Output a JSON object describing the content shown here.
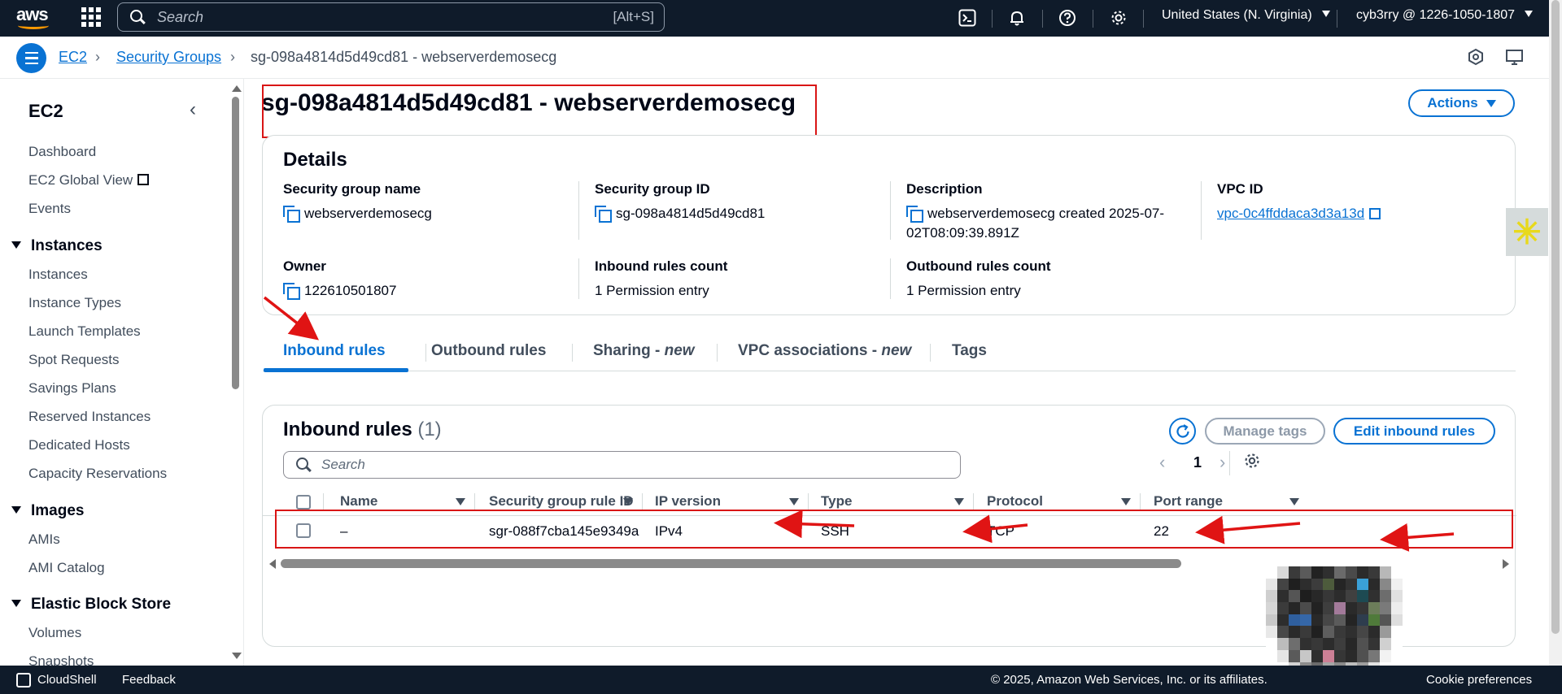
{
  "topnav": {
    "logo_text": "aws",
    "search_placeholder": "Search",
    "search_shortcut": "[Alt+S]",
    "region": "United States (N. Virginia)",
    "account": "cyb3rry @ 1226-1050-1807",
    "icons": [
      "cloudshell-icon",
      "bell-icon",
      "help-icon",
      "gear-icon"
    ]
  },
  "breadcrumb": {
    "items": [
      "EC2",
      "Security Groups",
      "sg-098a4814d5d49cd81 - webserverdemosecg"
    ]
  },
  "sidebar": {
    "title": "EC2",
    "top_items": [
      "Dashboard",
      "EC2 Global View",
      "Events"
    ],
    "sections": [
      {
        "title": "Instances",
        "items": [
          "Instances",
          "Instance Types",
          "Launch Templates",
          "Spot Requests",
          "Savings Plans",
          "Reserved Instances",
          "Dedicated Hosts",
          "Capacity Reservations"
        ]
      },
      {
        "title": "Images",
        "items": [
          "AMIs",
          "AMI Catalog"
        ]
      },
      {
        "title": "Elastic Block Store",
        "items": [
          "Volumes",
          "Snapshots"
        ]
      }
    ]
  },
  "page": {
    "title": "sg-098a4814d5d49cd81 - webserverdemosecg",
    "actions_label": "Actions"
  },
  "details": {
    "heading": "Details",
    "sg_name_label": "Security group name",
    "sg_name": "webserverdemosecg",
    "sg_id_label": "Security group ID",
    "sg_id": "sg-098a4814d5d49cd81",
    "description_label": "Description",
    "description_line1": "webserverdemosecg created 2025-07-",
    "description_line2": "02T08:09:39.891Z",
    "vpc_label": "VPC ID",
    "vpc_id": "vpc-0c4ffddaca3d3a13d",
    "owner_label": "Owner",
    "owner": "122610501807",
    "inbound_count_label": "Inbound rules count",
    "inbound_count": "1 Permission entry",
    "outbound_count_label": "Outbound rules count",
    "outbound_count": "1 Permission entry"
  },
  "tabs": [
    {
      "label": "Inbound rules",
      "suffix": ""
    },
    {
      "label": "Outbound rules",
      "suffix": ""
    },
    {
      "label": "Sharing - ",
      "suffix": "new"
    },
    {
      "label": "VPC associations - ",
      "suffix": "new"
    },
    {
      "label": "Tags",
      "suffix": ""
    }
  ],
  "inbound": {
    "heading": "Inbound rules",
    "count": "(1)",
    "manage_tags": "Manage tags",
    "edit_rules": "Edit inbound rules",
    "search_placeholder": "Search",
    "page": "1",
    "columns": [
      "Name",
      "Security group rule ID",
      "IP version",
      "Type",
      "Protocol",
      "Port range"
    ],
    "rows": [
      {
        "name": "–",
        "rule_id": "sgr-088f7cba145e9349a",
        "ip_version": "IPv4",
        "type": "SSH",
        "protocol": "TCP",
        "port_range": "22"
      }
    ]
  },
  "footer": {
    "cloudshell": "CloudShell",
    "feedback": "Feedback",
    "copyright": "© 2025, Amazon Web Services, Inc. or its affiliates.",
    "cookie": "Cookie preferences"
  },
  "colors": {
    "nav_bg": "#0f1b2a",
    "link_blue": "#0972d3",
    "annotation_red": "#d91515"
  }
}
